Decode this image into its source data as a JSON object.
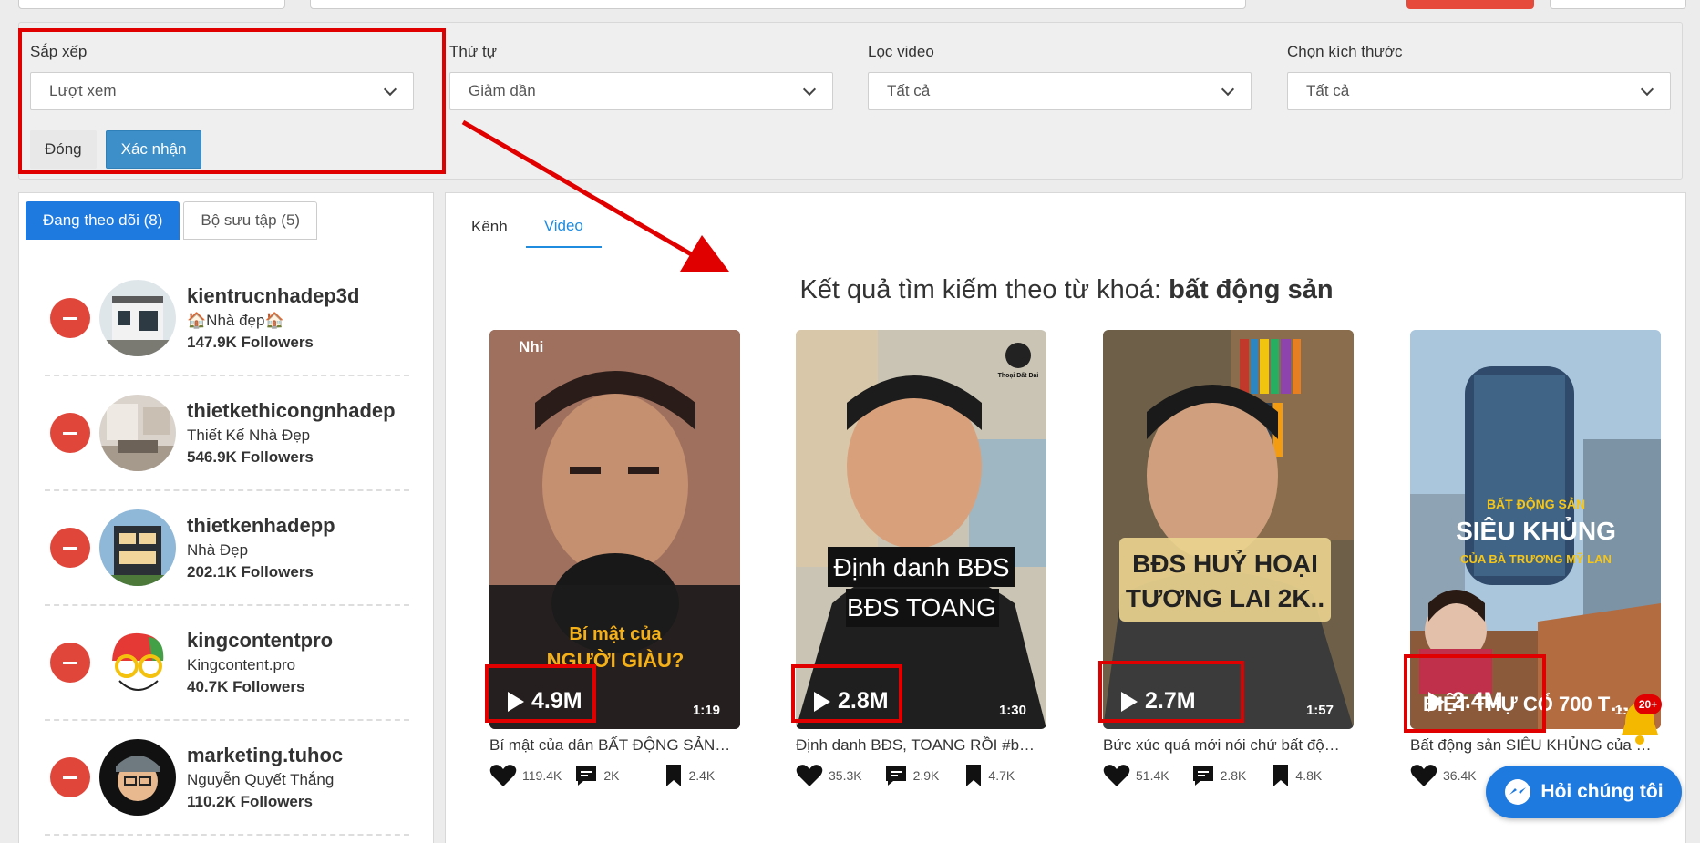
{
  "filters": {
    "sort": {
      "label": "Sắp xếp",
      "value": "Lượt xem"
    },
    "order": {
      "label": "Thứ tự",
      "value": "Giảm dần"
    },
    "video_filter": {
      "label": "Lọc video",
      "value": "Tất cả"
    },
    "size": {
      "label": "Chọn kích thước",
      "value": "Tất cả"
    },
    "close_label": "Đóng",
    "confirm_label": "Xác nhận"
  },
  "sidebar": {
    "tabs": [
      {
        "label": "Đang theo dõi (8)"
      },
      {
        "label": "Bộ sưu tập (5)"
      }
    ],
    "following": [
      {
        "name": "kientrucnhadep3d",
        "desc": "🏠Nhà đẹp🏠",
        "followers": "147.9K Followers"
      },
      {
        "name": "thietkethicongnhadep",
        "desc": "Thiết Kế Nhà Đẹp",
        "followers": "546.9K Followers"
      },
      {
        "name": "thietkenhadepp",
        "desc": "Nhà Đẹp",
        "followers": "202.1K Followers"
      },
      {
        "name": "kingcontentpro",
        "desc": "Kingcontent.pro",
        "followers": "40.7K Followers"
      },
      {
        "name": "marketing.tuhoc",
        "desc": "Nguyễn Quyết Thắng",
        "followers": "110.2K Followers"
      }
    ]
  },
  "main": {
    "tabs": [
      {
        "label": "Kênh"
      },
      {
        "label": "Video"
      }
    ],
    "result_prefix": "Kết quả tìm kiếm theo từ khoá: ",
    "keyword": "bất động sản",
    "videos": [
      {
        "views": "4.9M",
        "duration": "1:19",
        "title": "Bí mật của dân BẤT ĐỘNG SẢN…",
        "likes": "119.4K",
        "comments": "2K",
        "saves": "2.4K",
        "overlay_text_1": "Bí mật của",
        "overlay_text_2": "NGƯỜI GIÀU?",
        "watermark": "Nhi"
      },
      {
        "views": "2.8M",
        "duration": "1:30",
        "title": "Định danh BĐS, TOANG RỒI #b…",
        "likes": "35.3K",
        "comments": "2.9K",
        "saves": "4.7K",
        "overlay_text_1": "Định danh BĐS",
        "overlay_text_2": "BĐS TOANG",
        "watermark": "Thoại Đất Đai"
      },
      {
        "views": "2.7M",
        "duration": "1:57",
        "title": "Bức xúc quá mới nói chứ bất độ…",
        "likes": "51.4K",
        "comments": "2.8K",
        "saves": "4.8K",
        "overlay_text_1": "BĐS HUỶ HOẠI",
        "overlay_text_2": "TƯƠNG LAI 2K..",
        "watermark": ""
      },
      {
        "views": "2.4M",
        "duration": "1:…",
        "title": "Bất động sản SIÊU KHỦNG của …",
        "likes": "36.4K",
        "comments": "",
        "saves": "",
        "overlay_text_1": "BẤT ĐỘNG SẢN",
        "overlay_text_2": "SIÊU KHỦNG",
        "overlay_text_3": "CỦA BÀ TRƯƠNG MỸ LAN",
        "overlay_text_4": "BIỆT THỰ CỔ 700 T…",
        "watermark": ""
      }
    ]
  },
  "chat": {
    "label": "Hỏi chúng tôi"
  },
  "notification": {
    "badge": "20+"
  },
  "colors": {
    "primary": "#1f7ae0",
    "danger": "#e0463a",
    "annotation": "#e10000",
    "confirm": "#3d8fc9"
  }
}
